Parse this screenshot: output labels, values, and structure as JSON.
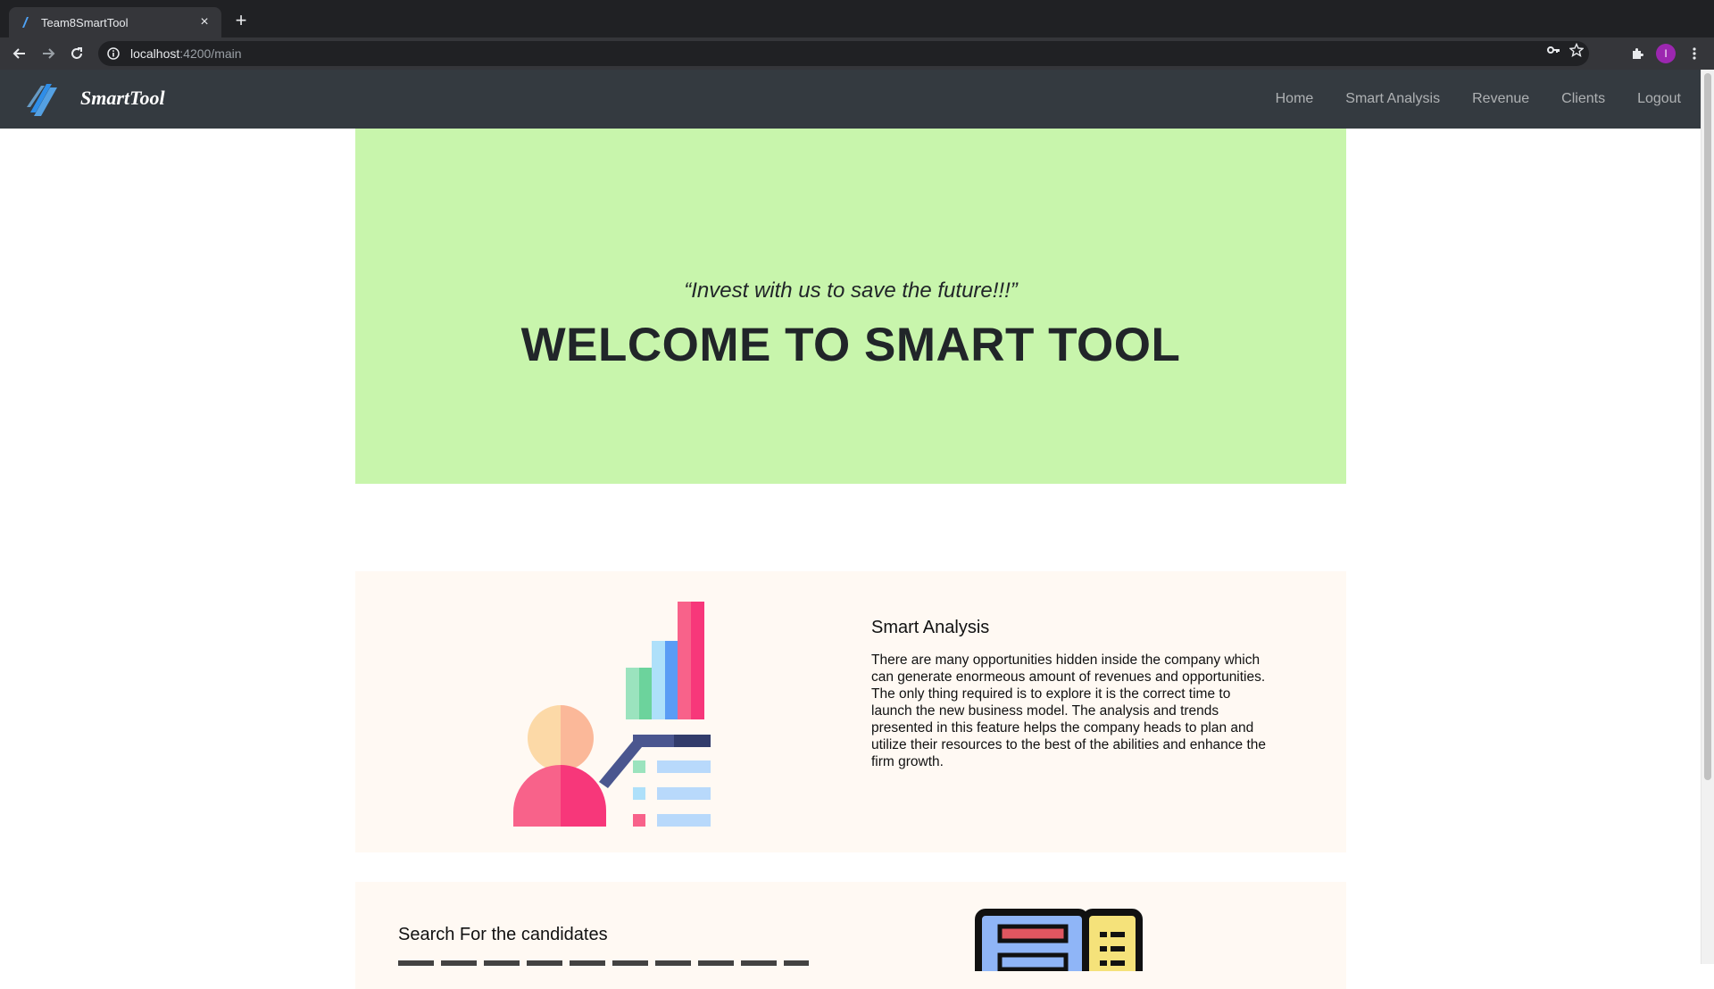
{
  "browser": {
    "tab_title": "Team8SmartTool",
    "tab_close": "×",
    "new_tab": "+",
    "url_host": "localhost",
    "url_path": ":4200/main",
    "profile_initial": "I"
  },
  "navbar": {
    "brand": "SmartTool",
    "links": [
      "Home",
      "Smart Analysis",
      "Revenue",
      "Clients",
      "Logout"
    ]
  },
  "hero": {
    "quote": "“Invest with us to save the future!!!”",
    "title": "WELCOME TO SMART TOOL",
    "background": "#c8f5ac"
  },
  "features": [
    {
      "heading": "Smart Analysis",
      "text_lines": [
        "There are many opportunities hidden inside the company which",
        "can generate enormeous amount of revenues and opportunities.",
        "The only thing required is to explore it is the correct time to",
        "launch the new business model. The analysis and trends",
        "presented in this feature helps the company heads to plan and",
        "utilize their resources to the best of the abilities and enhance the",
        "firm growth."
      ],
      "illustration": "analytics-presenter-illustration"
    },
    {
      "heading": "Search For the candidates",
      "illustration": "candidate-card-illustration"
    }
  ],
  "colors": {
    "navbar": "#343a40",
    "feature_bg": "#fff9f3",
    "accent_pink": "#f7377a",
    "accent_blue": "#5a9cf5"
  }
}
